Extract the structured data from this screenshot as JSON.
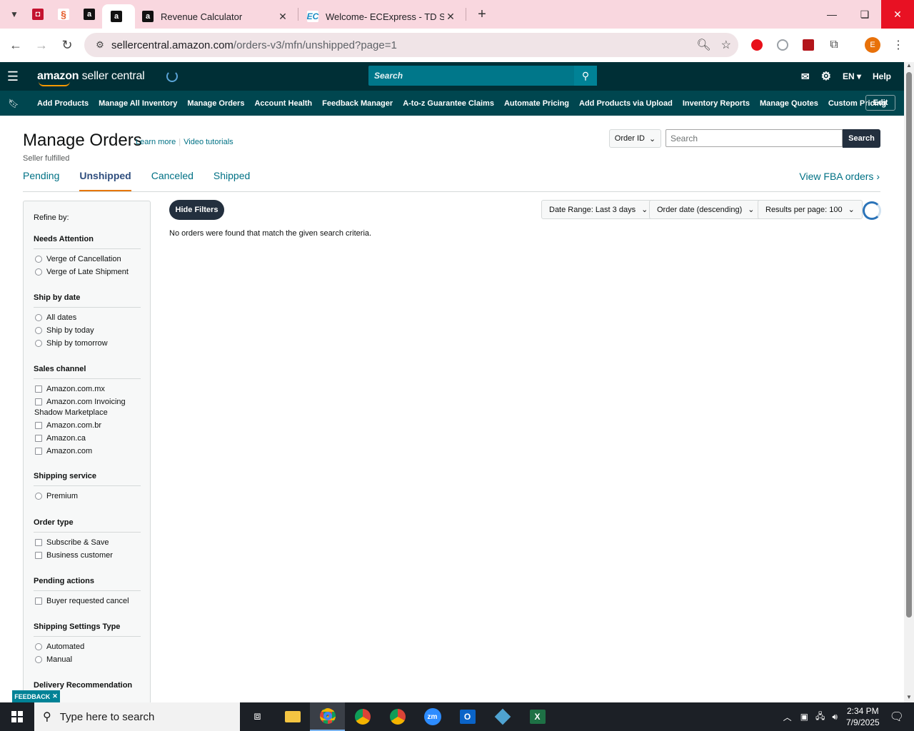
{
  "browser": {
    "tabs": [
      {
        "title": "Revenue Calculator",
        "active": true
      },
      {
        "title": "Welcome- ECExpress - TD SYNNEX",
        "active": false
      }
    ],
    "pinned_icons": [
      "dj-icon",
      "shopify-icon",
      "amazon-icon",
      "amazon-icon"
    ],
    "url_host": "sellercentral.amazon.com",
    "url_path": "/orders-v3/mfn/unshipped?page=1",
    "profile_initial": "E"
  },
  "header": {
    "logo_brand": "amazon",
    "logo_suffix": " seller central",
    "search_placeholder": "Search",
    "language": "EN",
    "help": "Help"
  },
  "menu": {
    "items": [
      "Add Products",
      "Manage All Inventory",
      "Manage Orders",
      "Account Health",
      "Feedback Manager",
      "A-to-z Guarantee Claims",
      "Automate Pricing",
      "Add Products via Upload",
      "Inventory Reports",
      "Manage Quotes",
      "Custom Pricing"
    ],
    "edit": "Edit"
  },
  "page": {
    "title": "Manage Orders",
    "learn_more": "Learn more",
    "video_tutorials": "Video tutorials",
    "subtitle": "Seller fulfilled",
    "order_id_select": "Order ID",
    "search_placeholder": "Search",
    "search_button": "Search",
    "tabs": [
      "Pending",
      "Unshipped",
      "Canceled",
      "Shipped"
    ],
    "active_tab": "Unshipped",
    "fba_link": "View FBA orders",
    "hide_filters": "Hide Filters",
    "date_range": "Date Range: Last 3 days",
    "sort": "Order date (descending)",
    "results_per_page": "Results per page: 100",
    "no_orders": "No orders were found that match the given search criteria.",
    "feedback": "FEEDBACK"
  },
  "filters": {
    "refine_by": "Refine by:",
    "needs_attention": {
      "title": "Needs Attention",
      "options": [
        "Verge of Cancellation",
        "Verge of Late Shipment"
      ]
    },
    "ship_by_date": {
      "title": "Ship by date",
      "options": [
        "All dates",
        "Ship by today",
        "Ship by tomorrow"
      ]
    },
    "sales_channel": {
      "title": "Sales channel",
      "options": [
        "Amazon.com.mx",
        "Amazon.com Invoicing",
        "Shadow Marketplace",
        "Amazon.com.br",
        "Amazon.ca",
        "Amazon.com"
      ]
    },
    "shipping_service": {
      "title": "Shipping service",
      "options": [
        "Premium"
      ]
    },
    "order_type": {
      "title": "Order type",
      "options": [
        "Subscribe & Save",
        "Business customer"
      ]
    },
    "pending_actions": {
      "title": "Pending actions",
      "options": [
        "Buyer requested cancel"
      ]
    },
    "shipping_settings": {
      "title": "Shipping Settings Type",
      "options": [
        "Automated",
        "Manual"
      ]
    },
    "delivery": {
      "title": "Delivery Recommendation"
    }
  },
  "taskbar": {
    "search_placeholder": "Type here to search",
    "time": "2:34 PM",
    "date": "7/9/2025"
  },
  "colors": {
    "tabstrip": "#f9d7df",
    "amazon_header": "#002f36",
    "amazon_menu": "#00464f",
    "link": "#007185",
    "accent": "#ff9900"
  }
}
